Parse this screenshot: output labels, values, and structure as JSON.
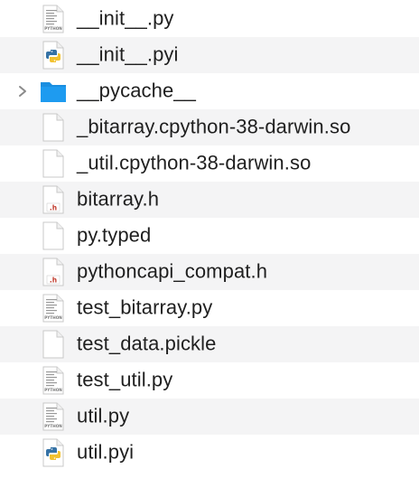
{
  "files": [
    {
      "name": "__init__.py",
      "icon": "python-script-icon",
      "alt": false
    },
    {
      "name": "__init__.pyi",
      "icon": "python-logo-file-icon",
      "alt": true
    },
    {
      "name": "__pycache__",
      "icon": "folder-icon",
      "alt": false,
      "expandable": true
    },
    {
      "name": "_bitarray.cpython-38-darwin.so",
      "icon": "blank-document-icon",
      "alt": true
    },
    {
      "name": "_util.cpython-38-darwin.so",
      "icon": "blank-document-icon",
      "alt": false
    },
    {
      "name": "bitarray.h",
      "icon": "c-header-file-icon",
      "alt": true
    },
    {
      "name": "py.typed",
      "icon": "blank-document-icon",
      "alt": false
    },
    {
      "name": "pythoncapi_compat.h",
      "icon": "c-header-file-icon",
      "alt": true
    },
    {
      "name": "test_bitarray.py",
      "icon": "python-script-icon",
      "alt": false
    },
    {
      "name": "test_data.pickle",
      "icon": "blank-document-icon",
      "alt": true
    },
    {
      "name": "test_util.py",
      "icon": "python-script-icon",
      "alt": false
    },
    {
      "name": "util.py",
      "icon": "python-script-icon",
      "alt": true
    },
    {
      "name": "util.pyi",
      "icon": "python-logo-file-icon",
      "alt": false
    }
  ],
  "icon_text": {
    "python_tag": "PYTHON",
    "header_tag": ".h"
  },
  "colors": {
    "stripe": "#f4f4f5",
    "folder": "#1e9bf0",
    "header_red": "#c0392b"
  }
}
